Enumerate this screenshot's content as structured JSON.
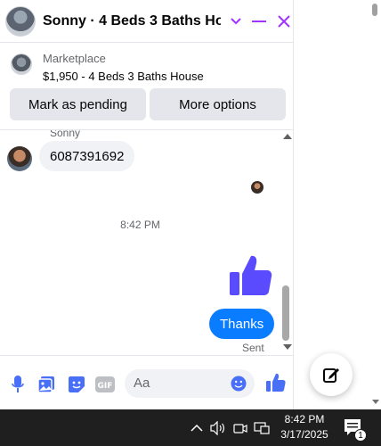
{
  "header": {
    "title": "Sonny · 4 Beds 3 Baths Ho...",
    "accent_color": "#a033ff"
  },
  "listing": {
    "category": "Marketplace",
    "summary": "$1,950 - 4 Beds 3 Baths House"
  },
  "actions": {
    "mark_pending": "Mark as pending",
    "more_options": "More options"
  },
  "messages": {
    "sender_name": "Sonny",
    "incoming_text": "6087391692",
    "time_separator": "8:42 PM",
    "outgoing_text": "Thanks",
    "outgoing_status": "Sent",
    "outgoing_color": "#0a7cff"
  },
  "composer": {
    "placeholder": "Aa"
  },
  "taskbar": {
    "time": "8:42 PM",
    "date": "3/17/2025",
    "notification_count": "1"
  }
}
